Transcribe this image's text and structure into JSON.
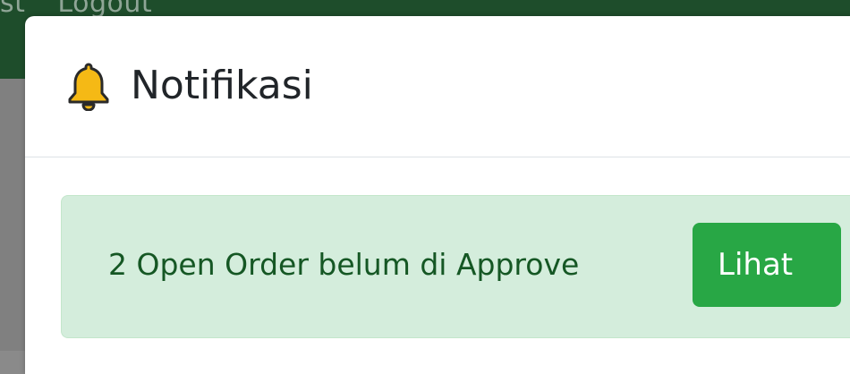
{
  "topbar": {
    "partial_label": "st",
    "logout_label": "Logout"
  },
  "modal": {
    "icon": "bell-icon",
    "title": "Notifikasi"
  },
  "alert": {
    "message": "2 Open Order belum di Approve",
    "button_label": "Lihat"
  },
  "colors": {
    "topbar": "#1e4d2b",
    "bell": "#f5b915",
    "alert_bg": "#d4eddc",
    "alert_text": "#155724",
    "button": "#28a745"
  }
}
